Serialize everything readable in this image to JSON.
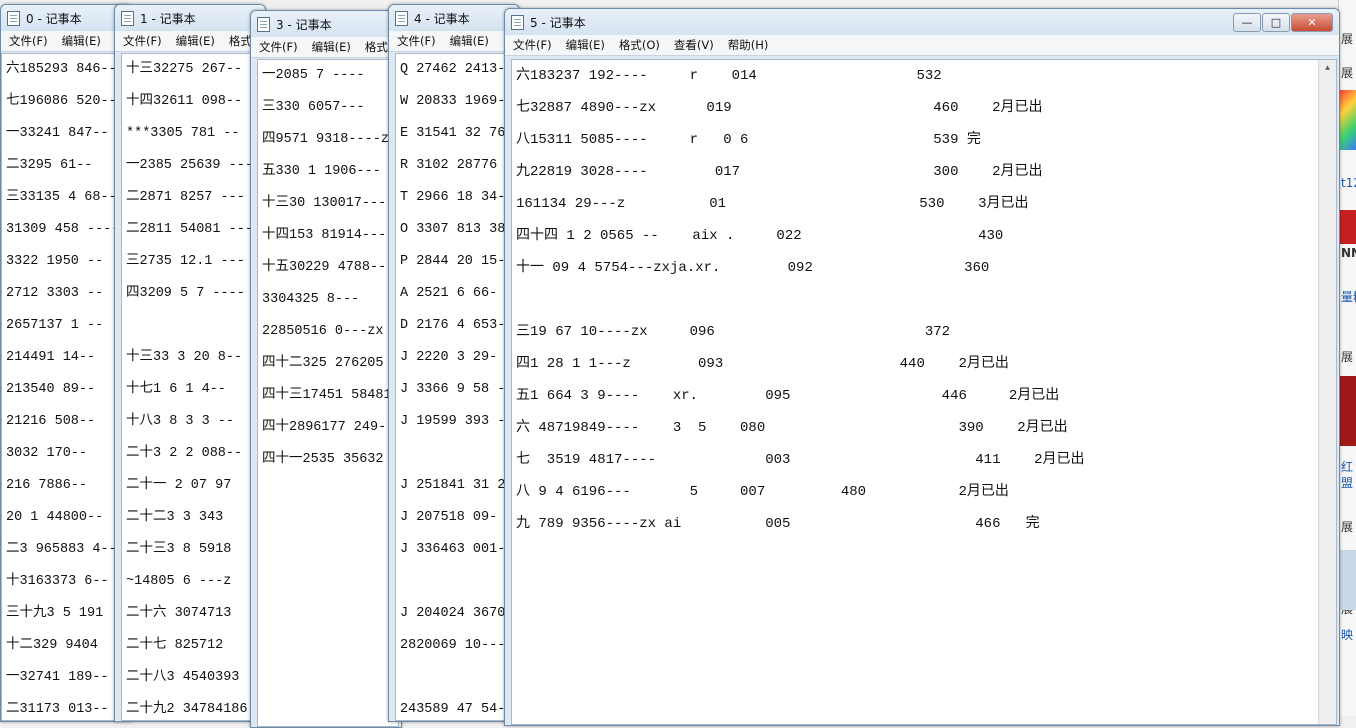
{
  "menu": {
    "file": "文件(F)",
    "edit": "编辑(E)",
    "format": "格式(O)",
    "view": "查看(V)",
    "help": "帮助(H)"
  },
  "windows": [
    {
      "title": "0 - 记事本",
      "lines": [
        "六185293 846--",
        "七196086 520--",
        "一33241 847--",
        "二3295 61--",
        "三33135 4 68--",
        "31309 458 ----",
        "3322 1950 --",
        "2712 3303  --",
        "2657137 1 --",
        "214491 14--",
        "213540 89--",
        "21216 508--",
        "3032 170--",
        "216 7886--",
        "20 1 44800--",
        "二3 965883 4--",
        "十3163373 6--",
        "三十九3 5 191",
        "十二329  9404",
        "一32741 189--",
        "二31173 013--"
      ]
    },
    {
      "title": "1 - 记事本",
      "lines": [
        "十三32275 267--",
        "十四32611 098--",
        "***3305 781 --",
        "一2385 25639 ---",
        "二2871 8257 ---",
        "二2811 54081 ---",
        "三2735 12.1 ---",
        "四3209 5 7 ----",
        "",
        "十三33 3 20 8--",
        "十七1 6 1 4--",
        "十八3 8 3 3 --",
        "二十3 2 2 088--",
        "二十一 2 07 97",
        "二十二3 3 343",
        "二十三3 8 5918",
        "~14805 6 ---z",
        "二十六 3074713",
        "二十七  825712",
        "二十八3 4540393",
        "二十九2 34784186"
      ]
    },
    {
      "title": "3 - 记事本",
      "lines": [
        "一2085 7 ----",
        "三330  6057---",
        "四9571 9318----z",
        "五330 1 1906---",
        "十三30 130017---",
        "十四153 81914---",
        "十五30229 4788---",
        "  3304325 8---",
        "22850516 0---zx",
        "四十二325 276205",
        "四十三17451 58481",
        "四十2896177 249--",
        "四十一2535 35632"
      ]
    },
    {
      "title": "4 - 记事本",
      "lines": [
        "Q 27462 2413--",
        "W 20833 1969-",
        "E 31541 32 76-",
        "R 3102 28776 -",
        "T 2966 18 34-",
        "O 3307 813 38-",
        "P 2844 20 15-",
        "A 2521 6 66-",
        "D 2176 4 653-",
        "J 2220 3 29-",
        "J 3366 9 58 -",
        "J 19599 393 -",
        "",
        "J 251841 31 2-",
        "J 207518 09-",
        "J 336463 001-",
        "",
        "J 204024 3670-",
        "2820069 10---",
        "",
        "243589 47 54---"
      ]
    },
    {
      "title": "5 - 记事本",
      "lines": [
        "六183237 192----     r    014                   532",
        "七32887 4890---zx      019                        460    2月已出",
        "八15311 5085----     r   0 6                      539 完",
        "九22819 3028----        017                       300    2月已出",
        "161134 29---z          01                       530    3月已出",
        "四十四 1 2 0565 --    aix .     022                     430",
        "十一 09 4 5754---zxja.xr.        092                  360",
        "",
        "三19 67 10----zx     096                         372",
        "四1 28 1 1---z        093                     440    2月已出",
        "五1 664 3 9----    xr.        095                  446     2月已出",
        "六 48719849----    3  5    080                       390    2月已出",
        "七  3519 4817----             003                      411    2月已出",
        "八 9 4 6196---       5     007         480           2月已出",
        "九 789 9356----zx ai          005                      466   完"
      ]
    }
  ],
  "right_edge": {
    "labels": [
      "展",
      "展",
      "t12",
      "NN",
      "量精",
      "展",
      "展",
      "红",
      "盟",
      "展",
      "展",
      "映"
    ]
  }
}
